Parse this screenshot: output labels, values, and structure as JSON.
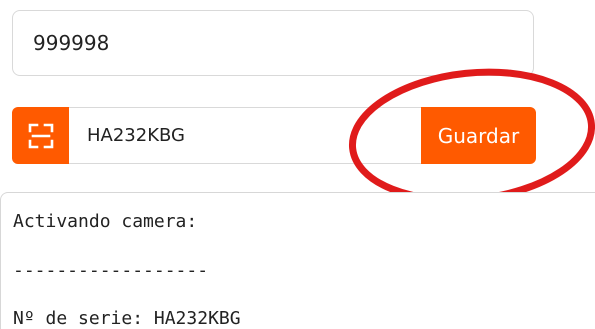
{
  "code_field": {
    "value": "999998"
  },
  "serial_input": {
    "value": "HA232KBG",
    "scan_icon": "barcode-scan-icon"
  },
  "save_button": {
    "label": "Guardar"
  },
  "log": {
    "lines": [
      "Activando camera:",
      "------------------",
      "Nº de serie: HA232KBG"
    ]
  },
  "colors": {
    "accent": "#ff5a00",
    "highlight_ring": "#e01b1b"
  }
}
